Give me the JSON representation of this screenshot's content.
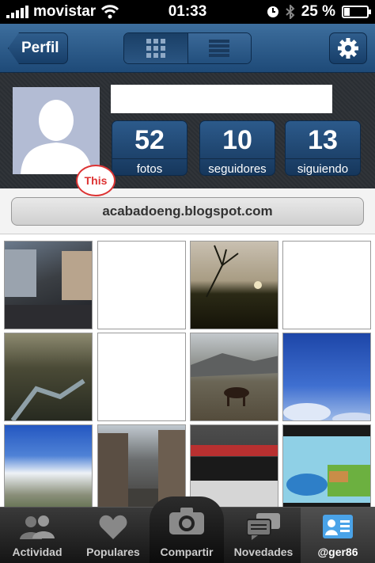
{
  "status_bar": {
    "carrier": "movistar",
    "time": "01:33",
    "battery": "25 %",
    "battery_level": 0.25
  },
  "nav": {
    "back_label": "Perfil",
    "view_modes": [
      "grid-view",
      "list-view"
    ],
    "active_view": "grid-view"
  },
  "profile": {
    "stats": [
      {
        "count": "52",
        "label": "fotos"
      },
      {
        "count": "10",
        "label": "seguidores"
      },
      {
        "count": "13",
        "label": "siguiendo"
      }
    ],
    "annotation": "This",
    "website": "acabadoeng.blogspot.com"
  },
  "tabs": [
    {
      "label": "Actividad",
      "icon": "people-icon"
    },
    {
      "label": "Populares",
      "icon": "heart-icon"
    },
    {
      "label": "Compartir",
      "icon": "camera-icon"
    },
    {
      "label": "Novedades",
      "icon": "chat-icon"
    },
    {
      "label": "@ger86",
      "icon": "profile-card-icon"
    }
  ],
  "active_tab": "@ger86",
  "colors": {
    "nav_blue": "#2c5a8b",
    "annotation_red": "#dd3333"
  }
}
